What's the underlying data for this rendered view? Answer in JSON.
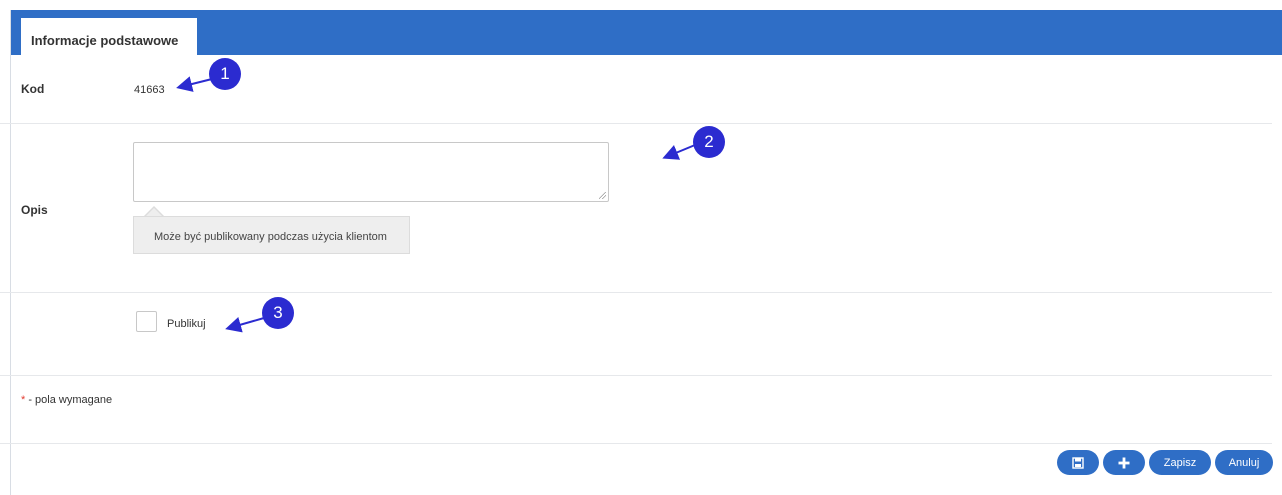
{
  "tabs": [
    {
      "label": "Informacje podstawowe",
      "active": true
    }
  ],
  "form": {
    "code": {
      "label": "Kod",
      "value": "41663"
    },
    "description": {
      "label": "Opis",
      "value": "",
      "hint": "Może być publikowany podczas użycia klientom"
    },
    "publish": {
      "label": "Publikuj",
      "checked": false
    },
    "required_note": {
      "star": "*",
      "text": " - pola wymagane"
    }
  },
  "footer": {
    "buttons": [
      {
        "name": "save-and-close-icon",
        "label": ""
      },
      {
        "name": "plus-icon",
        "label": ""
      },
      {
        "name": "save",
        "label": "Zapisz"
      },
      {
        "name": "cancel",
        "label": "Anuluj"
      }
    ]
  },
  "annotations": [
    "1",
    "2",
    "3"
  ],
  "colors": {
    "header": "#2f6ec6",
    "button": "#2f6ec6",
    "marker": "#2b2bd0",
    "required_star": "#e23b2f"
  }
}
